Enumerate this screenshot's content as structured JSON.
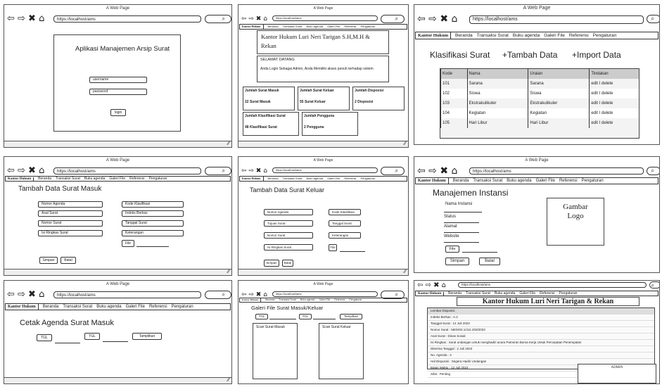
{
  "browser": {
    "window_title": "A Web Page",
    "url": "https://localhost/ams",
    "nav_glyphs": "⇦ ⇨ ✖ ⌂",
    "search_glyph": "⌕"
  },
  "navbar": {
    "brand": "Kantor Hukum",
    "items": [
      "Beranda",
      "Transaksi Surat",
      "Buku agenda",
      "Galeri File",
      "Referensi",
      "Pengaturan"
    ]
  },
  "login": {
    "title": "Aplikasi Manajemen Arsip Surat",
    "username_placeholder": "username",
    "password_placeholder": "password",
    "login_label": "login"
  },
  "dashboard": {
    "header": "Kantor Hukum Luri Neri Tarigan S.H,M.H & Rekan",
    "welcome_title": "SELAMAT DATANG",
    "welcome_text": "Anda Login Sebagai Admin, Anda Memiliki akses penuh terhadap sistem",
    "stats": [
      {
        "title": "Jumlah Surat Masuk",
        "value": "22 Surat Masuk"
      },
      {
        "title": "Jumlah Surat Keluar",
        "value": "55 Surat Keluar"
      },
      {
        "title": "Jumlah Disposisi",
        "value": "2 Disposisi"
      },
      {
        "title": "Jumlah Klasifikasi Surat",
        "value": "48 Klasifikasi Surat"
      },
      {
        "title": "Jumlah Pengguna",
        "value": "2 Pengguna"
      }
    ]
  },
  "klasifikasi": {
    "title": "Klasifikasi Surat",
    "add_label": "+Tambah Data",
    "import_label": "+Import Data",
    "columns": [
      "Kode",
      "Nama",
      "Uraian",
      "Tindakan"
    ],
    "rows": [
      [
        "101",
        "Sarana",
        "Sarana",
        "edit I delete"
      ],
      [
        "102",
        "Siswa",
        "Siswa",
        "edit I delete"
      ],
      [
        "103",
        "Ekstrakulikuler",
        "Ekstrakulikuler",
        "edit I delete"
      ],
      [
        "104",
        "Kegiatan",
        "Kegiatan",
        "edit I delete"
      ],
      [
        "105",
        "Hari Libur",
        "Hari Libur",
        "edit I delete"
      ]
    ]
  },
  "surat_masuk": {
    "title": "Tambah Data Surat Masuk",
    "fields_left": [
      "Nomor Agenda",
      "Asal Surat",
      "Nomor Surat",
      "Isi Ringkas Surat"
    ],
    "fields_right": [
      "Kode Klasifikasi",
      "Indeks Berkas",
      "Tanggal Surat",
      "Keterangan"
    ],
    "file_label": "File",
    "save_label": "Simpan",
    "cancel_label": "Batal"
  },
  "surat_keluar": {
    "title": "Tambah Data Surat Keluar",
    "fields_left": [
      "Nomor Agenda",
      "Tujuan Surat",
      "Nomor Surat",
      "Isi Ringkas Surat"
    ],
    "fields_right": [
      "Kode Klasifikasi",
      "Tanggal Surat",
      "Keterangan"
    ],
    "file_label": "File",
    "save_label": "Simpan",
    "cancel_label": "Batal"
  },
  "instansi": {
    "title": "Manajemen Instansi",
    "fields": [
      "Nama Instansi",
      "Status",
      "Alamat",
      "Website"
    ],
    "file_label": "File",
    "logo_label": "Gambar Logo",
    "save_label": "Simpan",
    "cancel_label": "Batal"
  },
  "agenda": {
    "title": "Cetak Agenda Surat Masuk",
    "tgl1": "TGL",
    "tgl2": "TGL",
    "show_label": "Tampilkan"
  },
  "galeri": {
    "title": "Galeri File Surat Masuk/Keluar",
    "tgl1": "TGL",
    "tgl2": "TGL",
    "show_label": "Tampilkan",
    "scan_in": "Scan Surat Masuk",
    "scan_out": "Scan Surat Keluar"
  },
  "disposisi": {
    "header": "Kantor Hukum Luri Neri Tarigan & Rekan",
    "lines": [
      "Lembar Disposisi",
      "Indeks Berkas : A.2",
      "Tanggal Surat : 12 Juli 2023",
      "Nomor Surat : 560/402.1/411.203/2023",
      "Asal Surat : Dinas Sosial",
      "Isi Ringkas : Surat undangan untuk menghadiri acara Pameran Bursa Kerja Untuk Percepatan Penempatan",
      "Diterima Tanggal : 2 Juli 2023",
      "No. Agenda : 4",
      "Hal Disposisi : Segera Hadiri Undangan",
      "Batas Waktu : 12 Juli 2023",
      "Sifat : Penting"
    ],
    "admin_label": "ADMIN"
  }
}
